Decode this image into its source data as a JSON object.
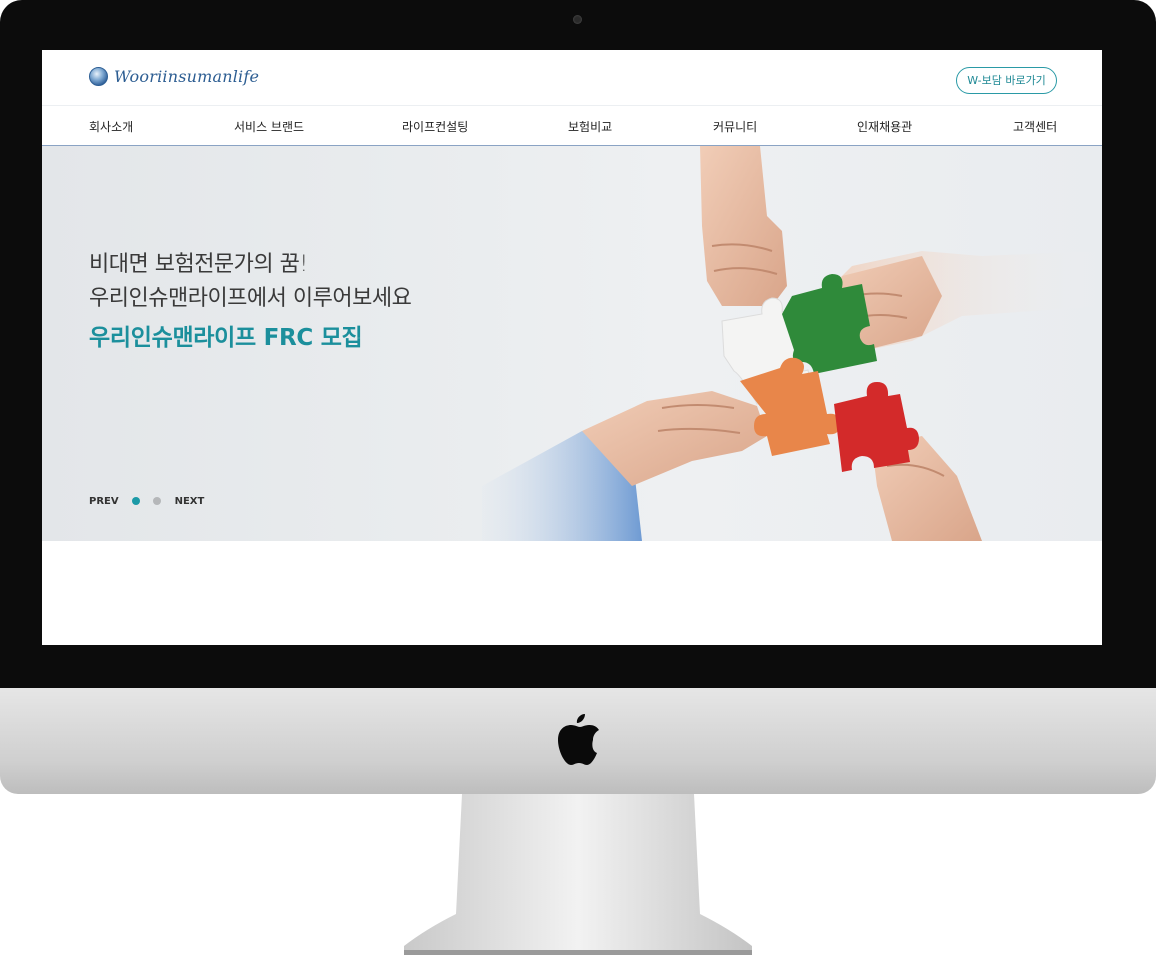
{
  "header": {
    "logo_text": "Wooriinsumanlife",
    "wboard_button": "W-보담 바로가기"
  },
  "nav": {
    "items": [
      {
        "label": "회사소개"
      },
      {
        "label": "서비스 브랜드"
      },
      {
        "label": "라이프컨설팅"
      },
      {
        "label": "보험비교"
      },
      {
        "label": "커뮤니티"
      },
      {
        "label": "인재채용관"
      },
      {
        "label": "고객센터"
      }
    ]
  },
  "hero": {
    "line1": "비대면  보험전문가의  꿈!",
    "line2": "우리인슈맨라이프에서  이루어보세요",
    "highlight": "우리인슈맨라이프  FRC  모집",
    "prev_label": "PREV",
    "next_label": "NEXT",
    "slide_count": 2,
    "active_slide": 1,
    "image": "hands-holding-puzzle-pieces"
  },
  "colors": {
    "accent": "#1b8f9c",
    "logo": "#2c5d92",
    "nav_border": "#8aa3c4",
    "puzzle_white": "#f2f2f2",
    "puzzle_green": "#2f8a3a",
    "puzzle_orange": "#e8864a",
    "puzzle_red": "#d32a2a"
  }
}
